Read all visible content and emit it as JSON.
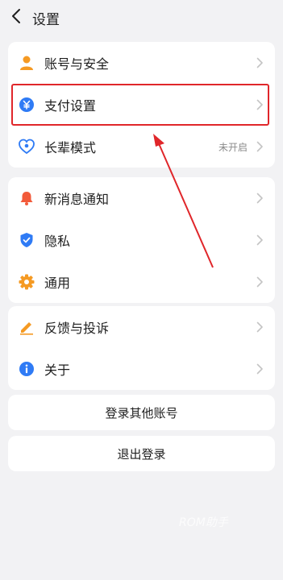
{
  "header": {
    "title": "设置"
  },
  "groups": [
    {
      "items": [
        {
          "label": "账号与安全",
          "icon": "person-icon"
        },
        {
          "label": "支付设置",
          "icon": "yuan-icon"
        },
        {
          "label": "长辈模式",
          "icon": "heart-icon",
          "value": "未开启"
        }
      ]
    },
    {
      "items": [
        {
          "label": "新消息通知",
          "icon": "bell-icon"
        },
        {
          "label": "隐私",
          "icon": "shield-icon"
        },
        {
          "label": "通用",
          "icon": "gear-icon"
        }
      ]
    },
    {
      "items": [
        {
          "label": "反馈与投诉",
          "icon": "edit-icon"
        },
        {
          "label": "关于",
          "icon": "info-icon"
        }
      ]
    }
  ],
  "buttons": {
    "login_other": "登录其他账号",
    "logout": "退出登录"
  },
  "watermark": "ROM助手",
  "colors": {
    "background": "#f2f2f4",
    "annotation": "#e0262a",
    "icon_orange": "#f59a23",
    "icon_blue": "#2f7bf5",
    "icon_red": "#f25a3a"
  }
}
